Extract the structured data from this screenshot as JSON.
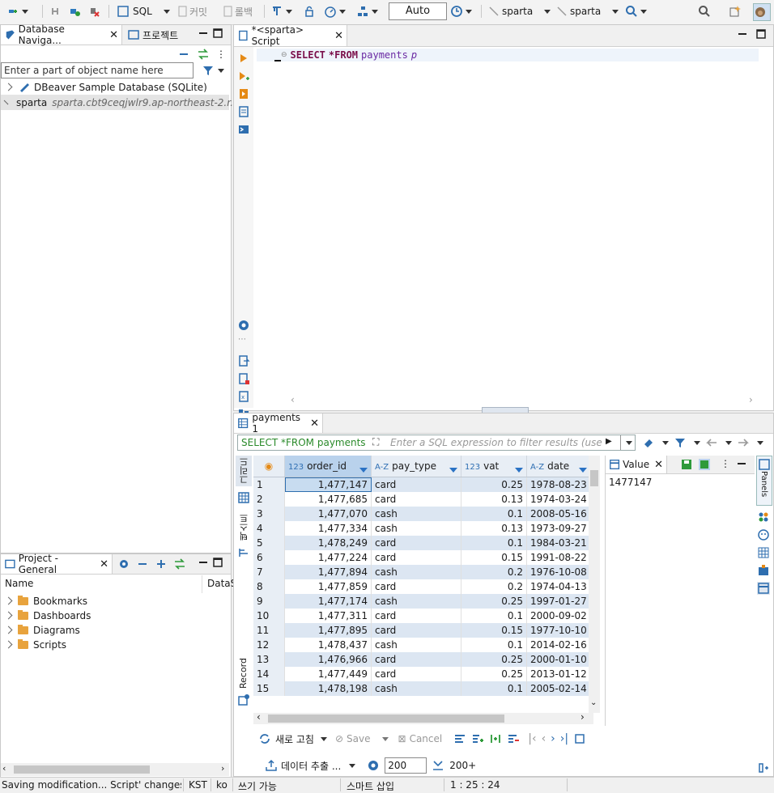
{
  "toolbar": {
    "sql_label": "SQL",
    "commit_label": "커밋",
    "rollback_label": "롤백",
    "transaction_mode": "Auto",
    "datasource": "sparta",
    "schema": "sparta"
  },
  "navigator": {
    "tab_label": "Database Naviga...",
    "project_tab_label": "프로젝트",
    "filter_placeholder": "Enter a part of object name here",
    "items": [
      {
        "label": "DBeaver Sample Database (SQLite)",
        "detail": ""
      },
      {
        "label": "sparta",
        "detail": "sparta.cbt9ceqjwlr9.ap-northeast-2.r..."
      }
    ]
  },
  "project": {
    "tab_label": "Project - General",
    "col_name": "Name",
    "col_datasource": "DataS",
    "items": [
      "Bookmarks",
      "Dashboards",
      "Diagrams",
      "Scripts"
    ]
  },
  "editor": {
    "tab_label": "*<sparta> Script",
    "sql_kw1": "SELECT",
    "sql_star": "*FROM",
    "sql_table": "payments",
    "sql_alias": "p"
  },
  "results": {
    "tab_label": "payments 1",
    "query_label": "SELECT *FROM payments",
    "filter_placeholder": "Enter a SQL expression to filter results (use Ctrl+",
    "side_grid_label": "그리드",
    "side_text_label": "텍스트",
    "side_record_label": "Record",
    "columns": [
      {
        "type": "123",
        "name": "order_id"
      },
      {
        "type": "A-Z",
        "name": "pay_type"
      },
      {
        "type": "123",
        "name": "vat"
      },
      {
        "type": "A-Z",
        "name": "date"
      }
    ],
    "rows": [
      [
        "1",
        "1,477,147",
        "card",
        "0.25",
        "1978-08-23"
      ],
      [
        "2",
        "1,477,685",
        "card",
        "0.13",
        "1974-03-24"
      ],
      [
        "3",
        "1,477,070",
        "cash",
        "0.1",
        "2008-05-16"
      ],
      [
        "4",
        "1,477,334",
        "cash",
        "0.13",
        "1973-09-27"
      ],
      [
        "5",
        "1,478,249",
        "card",
        "0.1",
        "1984-03-21"
      ],
      [
        "6",
        "1,477,224",
        "card",
        "0.15",
        "1991-08-22"
      ],
      [
        "7",
        "1,477,894",
        "cash",
        "0.2",
        "1976-10-08"
      ],
      [
        "8",
        "1,477,859",
        "card",
        "0.2",
        "1974-04-13"
      ],
      [
        "9",
        "1,477,174",
        "cash",
        "0.25",
        "1997-01-27"
      ],
      [
        "10",
        "1,477,311",
        "card",
        "0.1",
        "2000-09-02"
      ],
      [
        "11",
        "1,477,895",
        "card",
        "0.15",
        "1977-10-10"
      ],
      [
        "12",
        "1,478,437",
        "cash",
        "0.1",
        "2014-02-16"
      ],
      [
        "13",
        "1,476,966",
        "card",
        "0.25",
        "2000-01-10"
      ],
      [
        "14",
        "1,477,449",
        "card",
        "0.25",
        "2013-01-12"
      ],
      [
        "15",
        "1,478,198",
        "cash",
        "0.1",
        "2005-02-14"
      ]
    ],
    "value_panel_label": "Value",
    "value_panel_value": "1477147",
    "panels_label": "Panels",
    "refresh_label": "새로 고침",
    "save_label": "Save",
    "cancel_label": "Cancel",
    "export_label": "데이터 추출 ...",
    "fetch_size": "200",
    "fetch_more_label": "200+"
  },
  "status": {
    "message": "Saving modification... Script' changes...",
    "timezone": "KST",
    "locale": "ko",
    "write_mode": "쓰기 가능",
    "insert_mode": "스마트 삽입",
    "position": "1 : 25 : 24"
  }
}
